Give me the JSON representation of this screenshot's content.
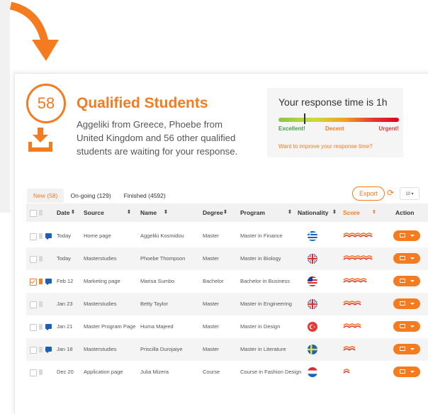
{
  "widget": {
    "count": "58",
    "title": "Qualified Students",
    "description": "Aggeliki from Greece, Phoebe from United Kingdom and 56 other qualified students are waiting for your response."
  },
  "response": {
    "title": "Your response time is 1h",
    "labels": {
      "excellent": "Excellent!",
      "decent": "Decent",
      "urgent": "Urgent!"
    },
    "level": 0.2,
    "improve_link": "Want to improve your response time?"
  },
  "tabs": [
    {
      "label": "New (58)",
      "active": true
    },
    {
      "label": "On-going (129)",
      "active": false
    },
    {
      "label": "Finished (4592)",
      "active": false
    }
  ],
  "toolbar": {
    "export_label": "Export",
    "per_page": "10 ▾"
  },
  "columns": {
    "date": "Date",
    "source": "Source",
    "name": "Name",
    "degree": "Degree",
    "program": "Program",
    "nationality": "Nationality",
    "score": "Score",
    "action": "Action"
  },
  "rows": [
    {
      "date": "Today",
      "source": "Home page",
      "name": "Aggeliki Kosmidou",
      "degree": "Master",
      "program": "Master in Finance",
      "nationality": "greece-flag",
      "score": 5,
      "checked": false,
      "bookmarked": false,
      "message": true
    },
    {
      "date": "Today",
      "source": "Masterstudies",
      "name": "Phoebe Thompson",
      "degree": "Master",
      "program": "Master in Biology",
      "nationality": "uk-flag",
      "score": 5,
      "checked": false,
      "bookmarked": false,
      "message": false
    },
    {
      "date": "Feb 12",
      "source": "Marketing page",
      "name": "Marisa Sumbo",
      "degree": "Bachelor",
      "program": "Bachelor in Business",
      "nationality": "usa-flag",
      "score": 4,
      "checked": true,
      "bookmarked": true,
      "message": true
    },
    {
      "date": "Jan 23",
      "source": "Masterstudies",
      "name": "Betty Taylor",
      "degree": "Master",
      "program": "Master in Engineering",
      "nationality": "uk-flag",
      "score": 3,
      "checked": false,
      "bookmarked": false,
      "message": false
    },
    {
      "date": "Jan 21",
      "source": "Master Program Page",
      "name": "Huma Majeed",
      "degree": "Master",
      "program": "Master in Design",
      "nationality": "turkey-flag",
      "score": 3,
      "checked": false,
      "bookmarked": false,
      "message": true
    },
    {
      "date": "Jan 18",
      "source": "Masterstudies",
      "name": "Priscilla Durojaiye",
      "degree": "Master",
      "program": "Master in Literature",
      "nationality": "sweden-flag",
      "score": 2,
      "checked": false,
      "bookmarked": false,
      "message": true
    },
    {
      "date": "Dec 20",
      "source": "Application page",
      "name": "Julia Mizera",
      "degree": "Course",
      "program": "Course in Fashion Design",
      "nationality": "netherlands-flag",
      "score": 1,
      "checked": false,
      "bookmarked": false,
      "message": false
    }
  ],
  "colors": {
    "accent": "#f47b20",
    "message": "#1e5fb4"
  }
}
